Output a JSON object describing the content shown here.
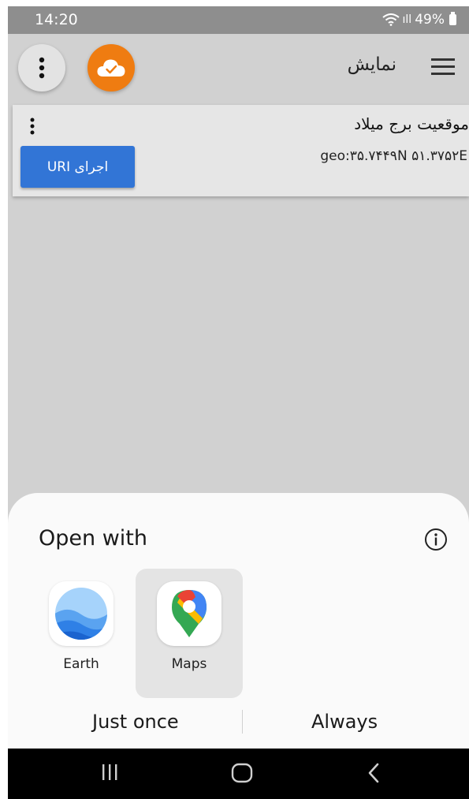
{
  "status_bar": {
    "time": "14:20",
    "signal_label": "ıll",
    "battery": "49%"
  },
  "toolbar": {
    "title": "نمایش",
    "menu_icon": "more-vert-icon",
    "cloud_icon": "cloud-check-icon",
    "hamburger_icon": "hamburger-menu-icon",
    "cloud_color": "#ef7c11"
  },
  "card": {
    "title": "موقعیت برج میلاد",
    "geo": "geo:۳۵.۷۴۴۹N ۵۱.۳۷۵۲E",
    "run_button_label": "اجرای URI",
    "button_color": "#3275d6"
  },
  "sheet": {
    "title": "Open with",
    "apps": [
      {
        "label": "Earth",
        "icon": "google-earth-icon",
        "selected": false
      },
      {
        "label": "Maps",
        "icon": "google-maps-icon",
        "selected": true
      }
    ],
    "just_once_label": "Just once",
    "always_label": "Always"
  },
  "nav_bar": {
    "recents_icon": "recents-icon",
    "home_icon": "home-icon",
    "back_icon": "back-icon"
  }
}
